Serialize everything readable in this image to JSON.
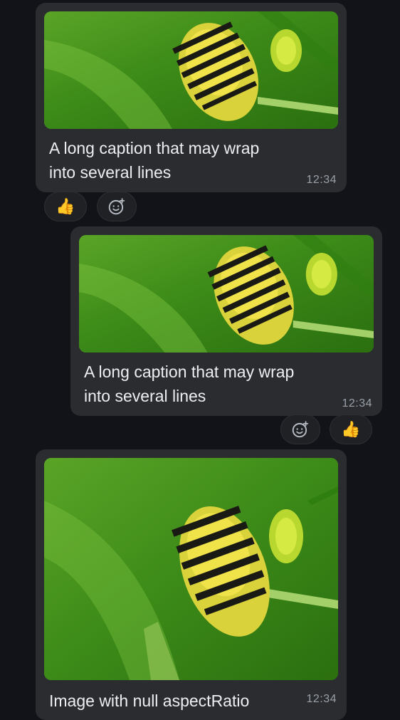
{
  "messages": [
    {
      "caption": "A long caption that may wrap into several lines",
      "time": "12:34",
      "reaction_emoji": "👍",
      "add_reaction_icon": "emoji-add-icon",
      "side": "incoming"
    },
    {
      "caption": "A long caption that may wrap into several lines",
      "time": "12:34",
      "reaction_emoji": "👍",
      "add_reaction_icon": "emoji-add-icon",
      "side": "outgoing"
    },
    {
      "caption": "Image with null aspectRatio",
      "time": "12:34",
      "side": "incoming"
    }
  ],
  "colors": {
    "background": "#111318",
    "bubble": "#2a2c30",
    "timestamp": "#9aa0a8"
  }
}
